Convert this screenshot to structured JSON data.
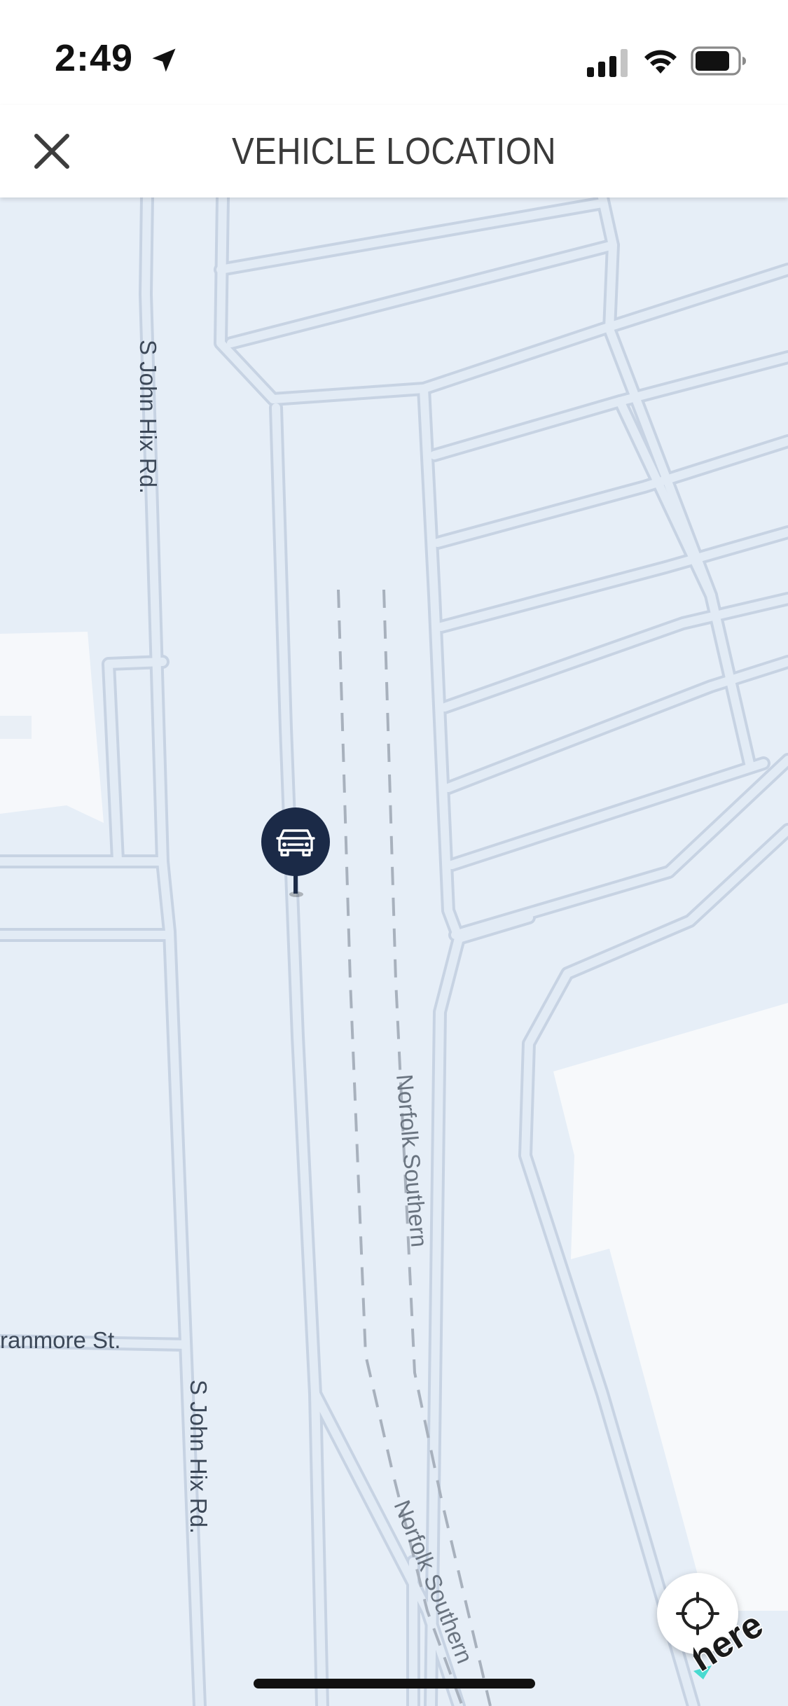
{
  "status_bar": {
    "time": "2:49",
    "icons": [
      "location-arrow-icon",
      "cellular-signal-icon",
      "wifi-icon",
      "battery-icon"
    ]
  },
  "header": {
    "title": "VEHICLE LOCATION",
    "close_icon": "close-icon"
  },
  "map": {
    "labels": {
      "road_north": "S John Hix Rd.",
      "road_south": "S John Hix Rd.",
      "street_west": "ranmore St.",
      "rail_mid": "Norfolk Southern",
      "rail_south": "Norfolk Southern"
    },
    "marker_icon": "vehicle-icon",
    "provider_logo": "here"
  },
  "controls": {
    "locate_icon": "crosshair-locate-icon"
  },
  "colors": {
    "map_background": "#e6eef7",
    "road_fill": "#ffffff",
    "road_edge": "#c9d4e3",
    "marker": "#1b2a47"
  }
}
